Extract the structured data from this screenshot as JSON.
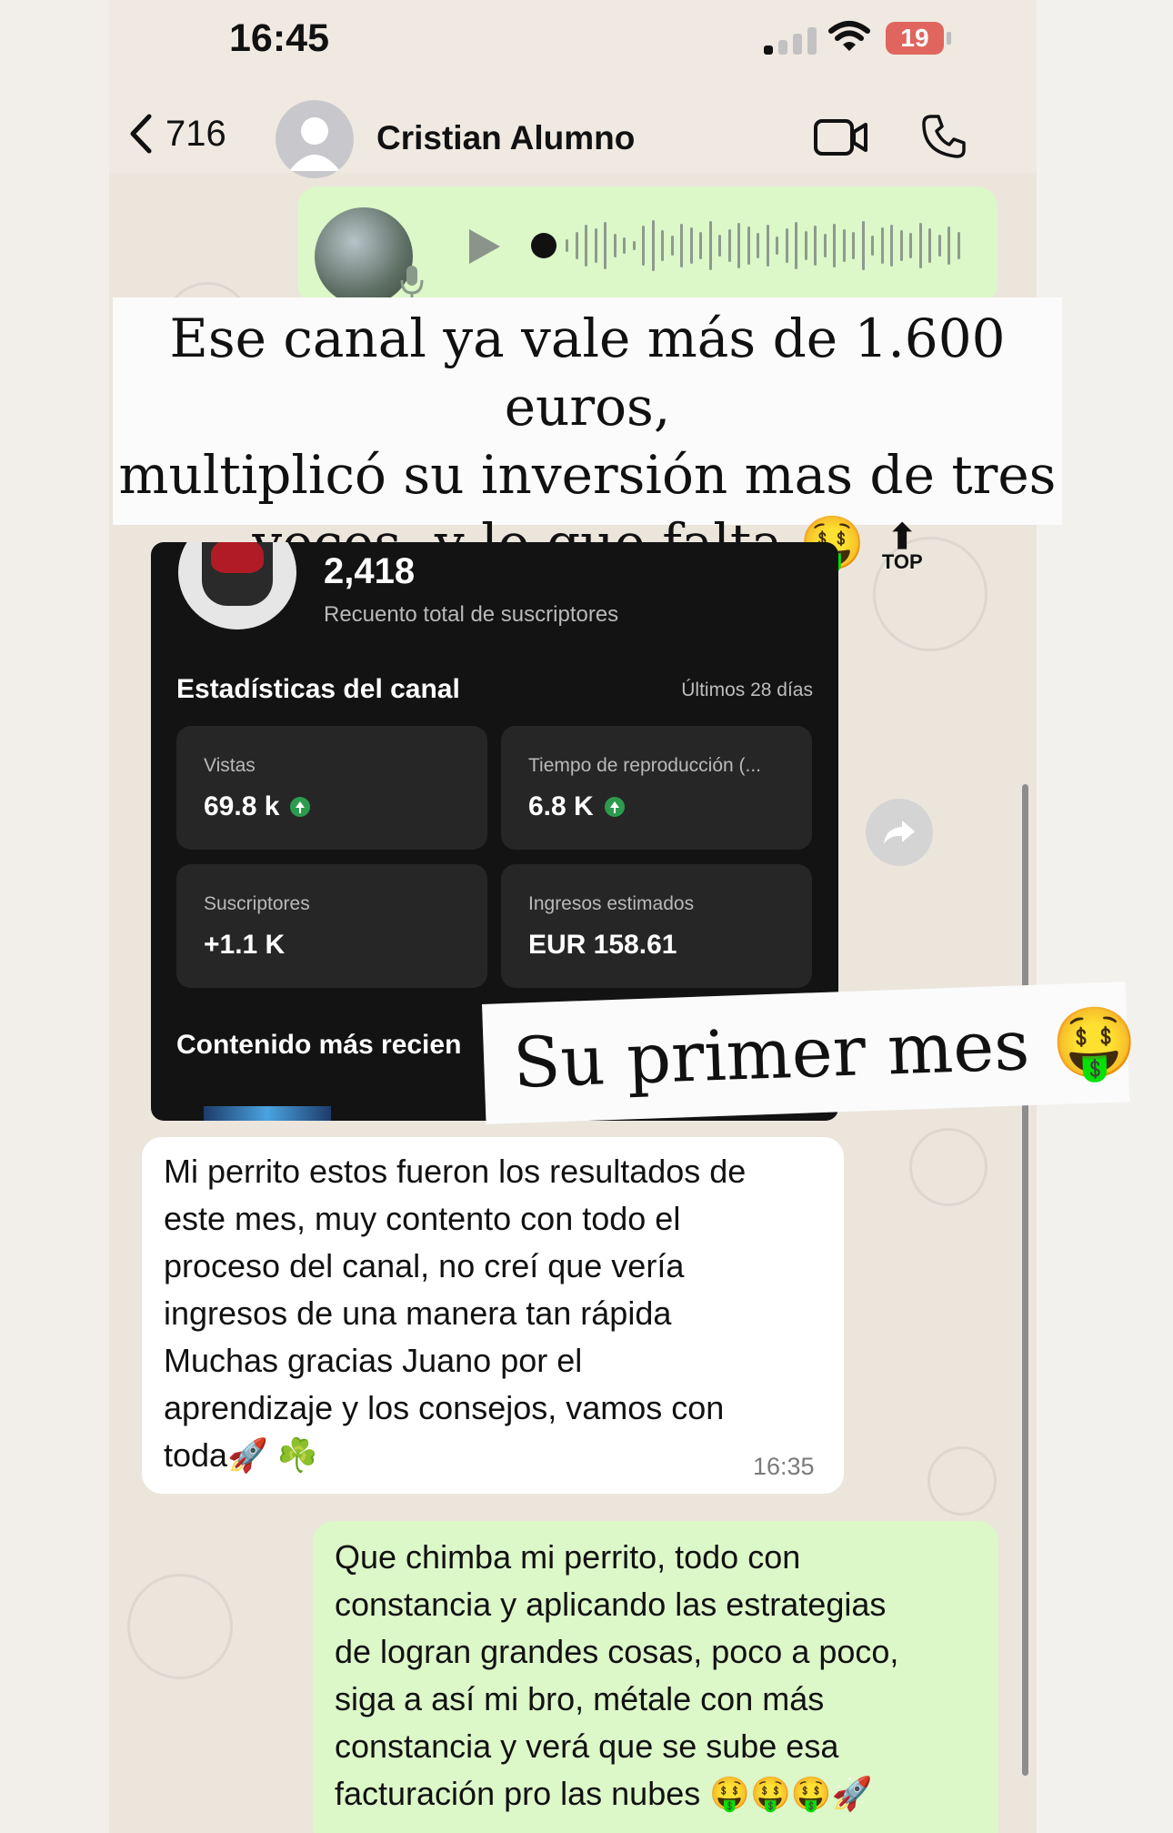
{
  "status_bar": {
    "time": "16:45",
    "battery": "19"
  },
  "header": {
    "back_count": "716",
    "contact_name": "Cristian Alumno"
  },
  "captions": {
    "caption1_lines": [
      "Ese canal ya vale más de 1.600 euros,",
      "multiplicó su inversión mas de tres",
      "veces, y lo que falta 🤑"
    ],
    "top_label": "TOP",
    "caption2": "Su primer mes 🤑"
  },
  "screenshot": {
    "subscriber_count": "2,418",
    "subscriber_label": "Recuento total de suscriptores",
    "stats_title": "Estadísticas del canal",
    "stats_period": "Últimos 28 días",
    "cards": [
      {
        "label": "Vistas",
        "value": "69.8 k"
      },
      {
        "label": "Tiempo de reproducción (...",
        "value": "6.8 K"
      },
      {
        "label": "Suscriptores",
        "value": "+1.1 K"
      },
      {
        "label": "Ingresos estimados",
        "value": "EUR 158.61"
      }
    ],
    "recent_title": "Contenido más recien"
  },
  "messages": {
    "incoming_lines": [
      "Mi perrito estos fueron los resultados de",
      "este mes, muy contento con todo el",
      "proceso del canal, no creí que vería",
      "ingresos de una manera tan rápida",
      "Muchas gracias Juano por el",
      "aprendizaje y los consejos, vamos con",
      "toda🚀 ☘️"
    ],
    "incoming_time": "16:35",
    "outgoing_lines": [
      "Que chimba mi perrito, todo con",
      "constancia y aplicando las estrategias",
      "de logran grandes cosas, poco a poco,",
      "siga a así mi bro, métale con más",
      "constancia y verá que se sube esa",
      "facturación pro las nubes 🤑🤑🤑🚀"
    ]
  },
  "icons": {
    "back": "chevron-left-icon",
    "video": "video-camera-icon",
    "phone": "phone-icon",
    "play": "play-icon",
    "mic": "microphone-icon",
    "forward": "forward-icon",
    "up_arrow": "up-arrow-icon"
  },
  "colors": {
    "outgoing_bubble": "#dcf7c8",
    "incoming_bubble": "#ffffff",
    "screenshot_bg": "#131313",
    "card_bg": "#262626",
    "battery_low": "#e0655f",
    "growth_green": "#2d9b4e"
  }
}
